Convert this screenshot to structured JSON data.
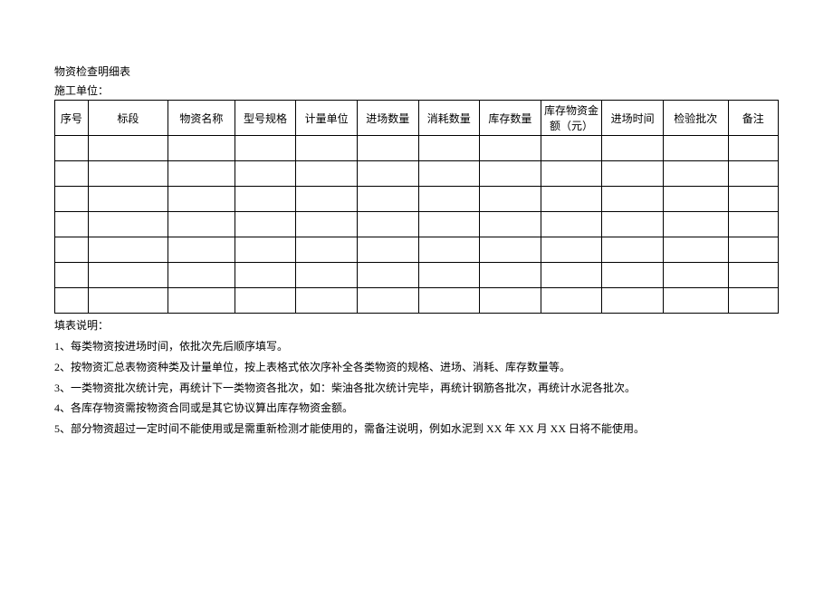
{
  "title": "物资检查明细表",
  "subtitle": "施工单位：",
  "headers": [
    "序号",
    "标段",
    "物资名称",
    "型号规格",
    "计量单位",
    "进场数量",
    "消耗数量",
    "库存数量",
    "库存物资金额（元）",
    "进场时间",
    "检验批次",
    "备注"
  ],
  "rows": [
    [
      "",
      "",
      "",
      "",
      "",
      "",
      "",
      "",
      "",
      "",
      "",
      ""
    ],
    [
      "",
      "",
      "",
      "",
      "",
      "",
      "",
      "",
      "",
      "",
      "",
      ""
    ],
    [
      "",
      "",
      "",
      "",
      "",
      "",
      "",
      "",
      "",
      "",
      "",
      ""
    ],
    [
      "",
      "",
      "",
      "",
      "",
      "",
      "",
      "",
      "",
      "",
      "",
      ""
    ],
    [
      "",
      "",
      "",
      "",
      "",
      "",
      "",
      "",
      "",
      "",
      "",
      ""
    ],
    [
      "",
      "",
      "",
      "",
      "",
      "",
      "",
      "",
      "",
      "",
      "",
      ""
    ],
    [
      "",
      "",
      "",
      "",
      "",
      "",
      "",
      "",
      "",
      "",
      "",
      ""
    ]
  ],
  "notes_title": "填表说明：",
  "notes": [
    "1、每类物资按进场时间，依批次先后顺序填写。",
    "2、按物资汇总表物资种类及计量单位，按上表格式依次序补全各类物资的规格、进场、消耗、库存数量等。",
    "3、一类物资批次统计完，再统计下一类物资各批次，如：柴油各批次统计完毕，再统计钢筋各批次，再统计水泥各批次。",
    "4、各库存物资需按物资合同或是其它协议算出库存物资金额。",
    "5、部分物资超过一定时间不能使用或是需重新检测才能使用的，需备注说明，例如水泥到 XX 年 XX 月 XX 日将不能使用。"
  ]
}
